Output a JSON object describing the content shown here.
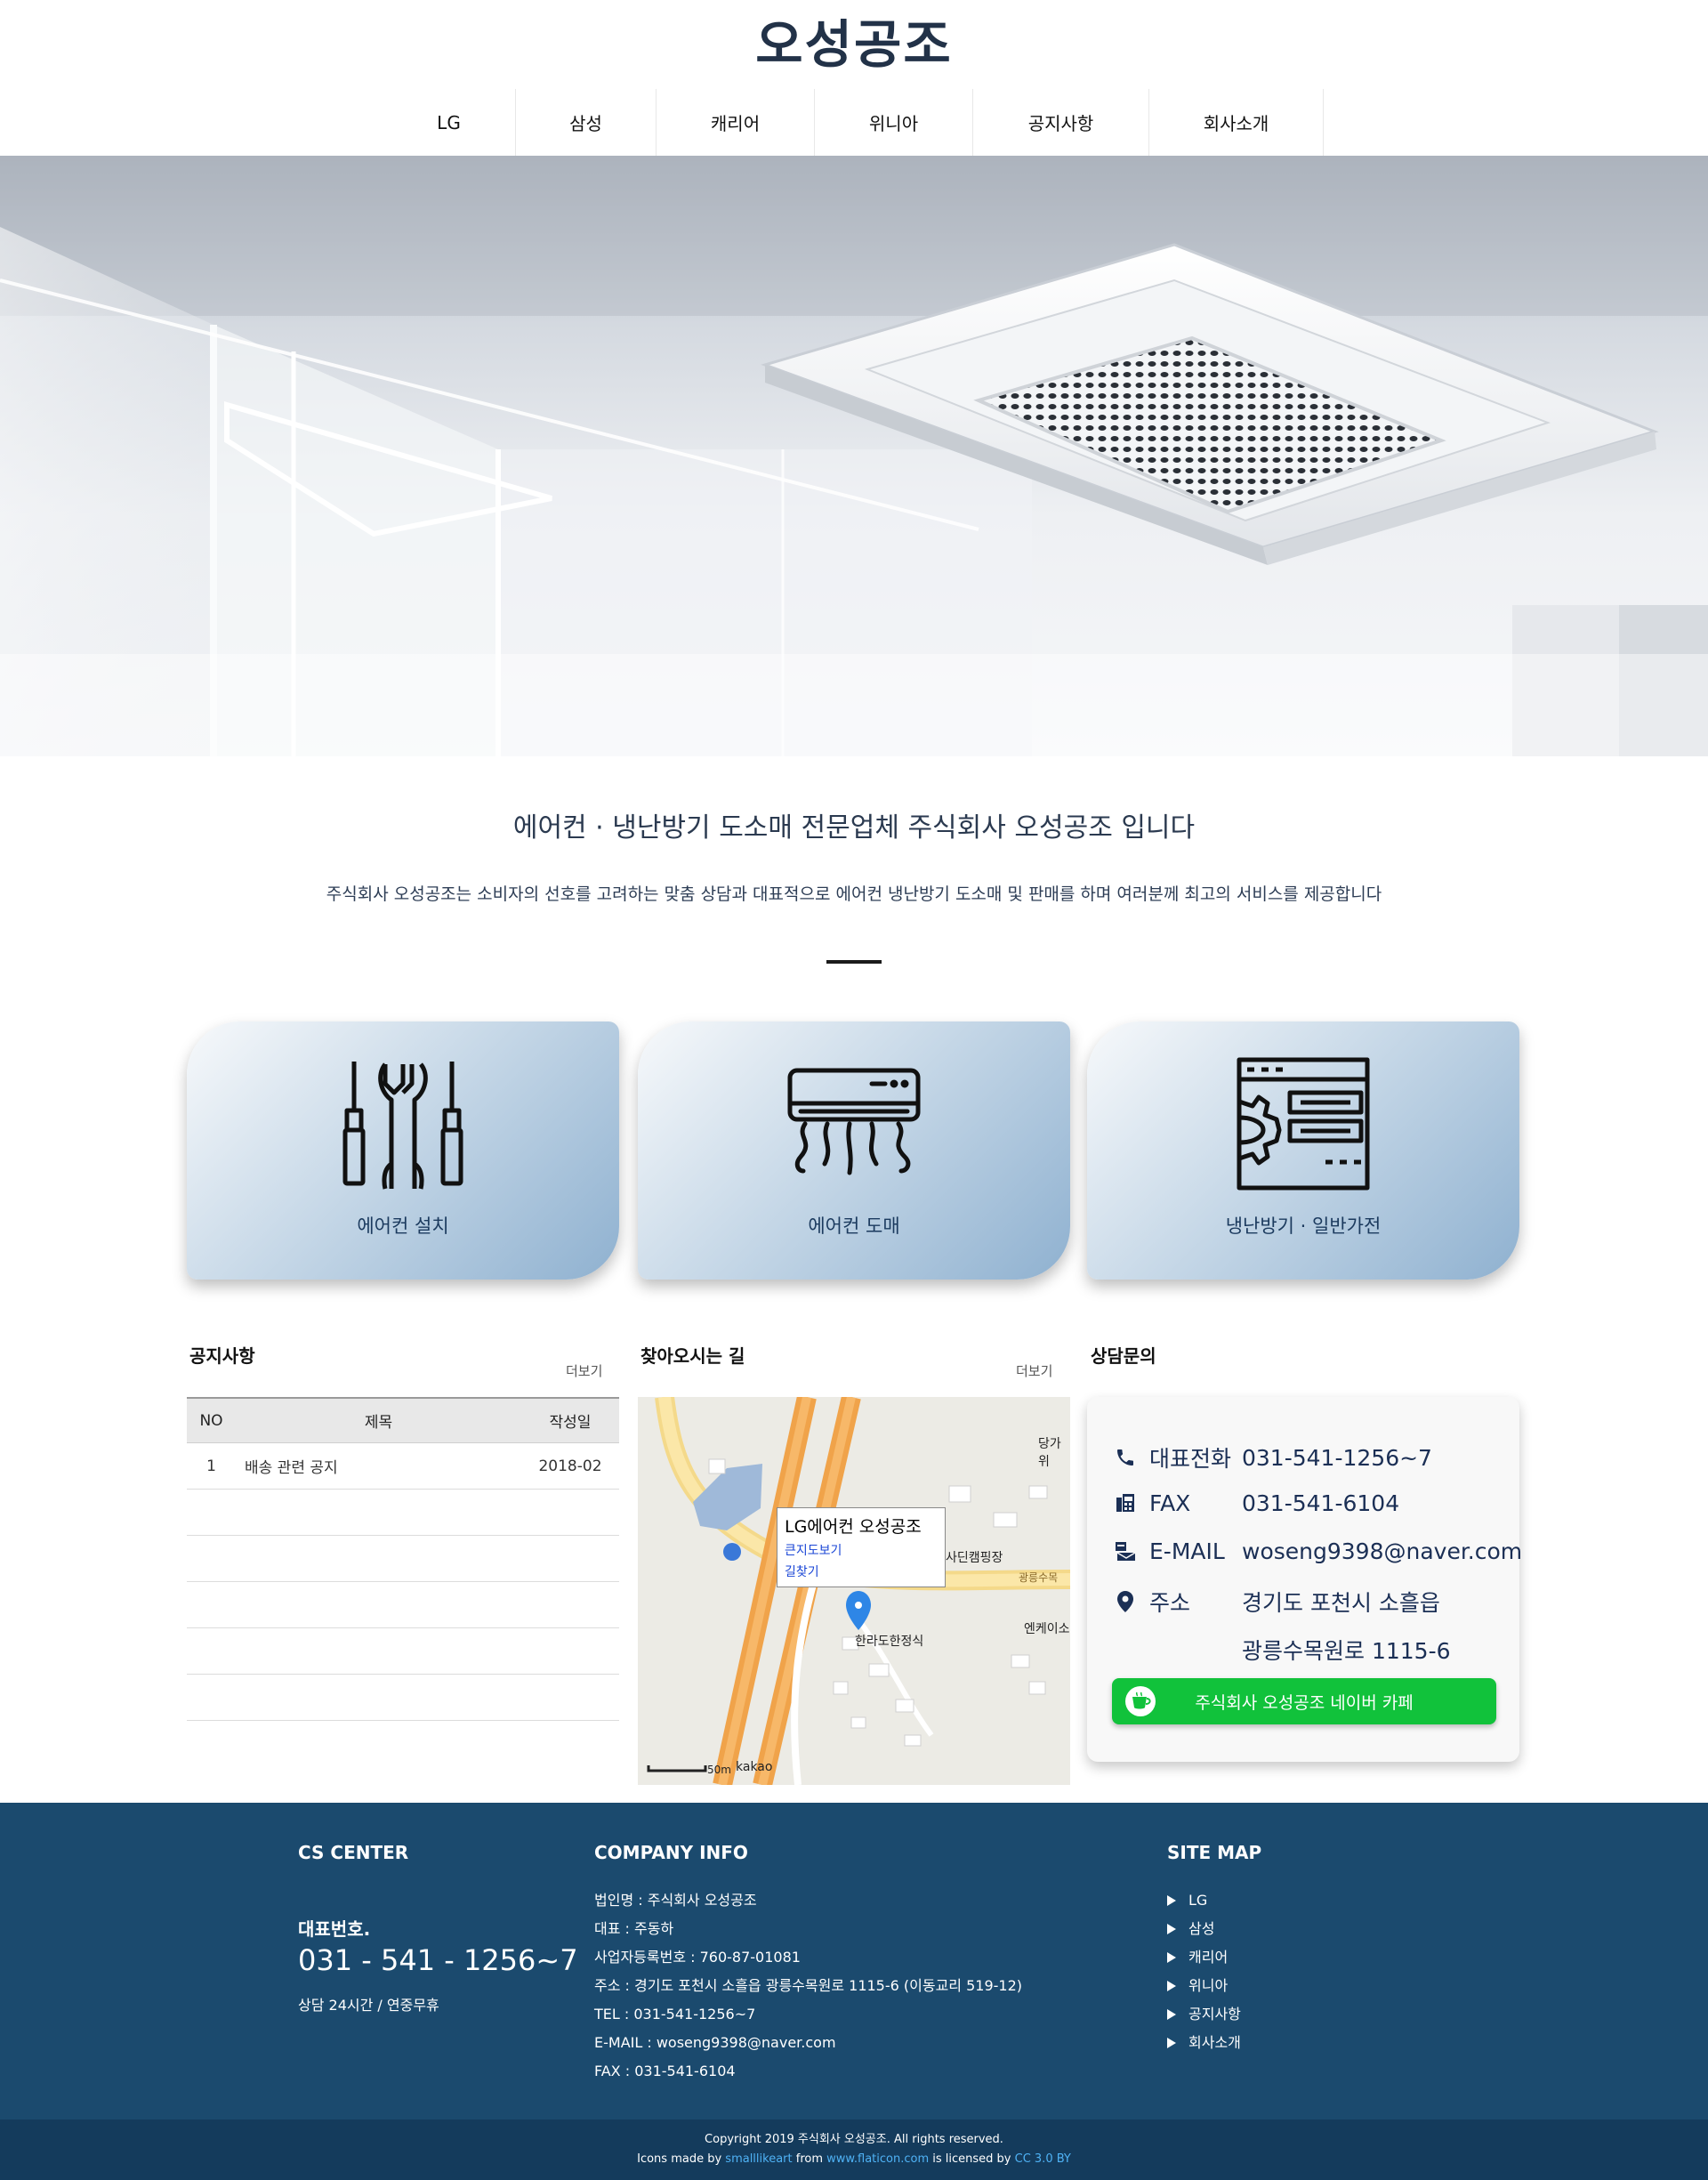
{
  "header": {
    "logo": "오성공조",
    "nav": [
      "LG",
      "삼성",
      "캐리어",
      "위니아",
      "공지사항",
      "회사소개"
    ]
  },
  "intro": {
    "title": "에어컨 · 냉난방기 도소매 전문업체 주식회사 오성공조 입니다",
    "description": "주식회사 오성공조는 소비자의 선호를 고려하는 맞춤 상담과 대표적으로 에어컨 냉난방기 도소매 및 판매를 하며 여러분께 최고의 서비스를 제공합니다"
  },
  "services": [
    {
      "label": "에어컨 설치",
      "icon": "tools-icon"
    },
    {
      "label": "에어컨 도매",
      "icon": "air-conditioner-icon"
    },
    {
      "label": "냉난방기 · 일반가전",
      "icon": "gear-window-icon"
    }
  ],
  "notice": {
    "title": "공지사항",
    "more": "더보기",
    "headers": {
      "no": "NO",
      "title": "제목",
      "date": "작성일"
    },
    "rows": [
      {
        "no": "1",
        "title": "배송 관련 공지",
        "date": "2018-02"
      }
    ]
  },
  "map": {
    "title": "찾아오시는 길",
    "more": "더보기",
    "popup_title": "LG에어컨 오성공조",
    "popup_link1": "큰지도보기",
    "popup_link2": "길찾기",
    "labels": {
      "cafe": "당가위",
      "camping": "사딘캠핑장",
      "road": "광릉수목",
      "store": "엔케이소",
      "restaurant": "한라도한정식",
      "scale": "50m",
      "brand": "kakao"
    }
  },
  "contact": {
    "title": "상담문의",
    "phone_label": "대표전화",
    "phone": "031-541-1256~7",
    "fax_label": "FAX",
    "fax": "031-541-6104",
    "email_label": "E-MAIL",
    "email": "woseng9398@naver.com",
    "address_label": "주소",
    "address_line1": "경기도 포천시 소흘읍",
    "address_line2": "광릉수목원로 1115-6",
    "cafe_button": "주식회사 오성공조 네이버 카페"
  },
  "footer": {
    "cs_title": "CS CENTER",
    "cs_label": "대표번호.",
    "cs_phone": "031 - 541 - 1256~7",
    "cs_hours": "상담 24시간 / 연중무휴",
    "company_title": "COMPANY INFO",
    "company_lines": [
      "법인명 : 주식회사 오성공조",
      "대표 : 주동하",
      "사업자등록번호 : 760-87-01081",
      "주소 : 경기도 포천시 소흘읍 광릉수목원로 1115-6 (이동교리 519-12)",
      "TEL : 031-541-1256~7",
      "E-MAIL : woseng9398@naver.com",
      "FAX : 031-541-6104"
    ],
    "sitemap_title": "SITE MAP",
    "sitemap": [
      "LG",
      "삼성",
      "캐리어",
      "위니아",
      "공지사항",
      "회사소개"
    ],
    "copyright": "Copyright 2019 주식회사 오성공조. All rights reserved.",
    "credit_prefix": "Icons made by",
    "credit_author": "smalllikeart",
    "credit_from": "from",
    "credit_site": "www.flaticon.com",
    "credit_licensed": "is licensed by",
    "credit_license": "CC 3.0 BY"
  },
  "colors": {
    "navy": "#1b4a6e",
    "footer_bottom": "#143b5c",
    "cafe_green": "#11c23b",
    "text_dark_blue": "#1b2f55"
  }
}
